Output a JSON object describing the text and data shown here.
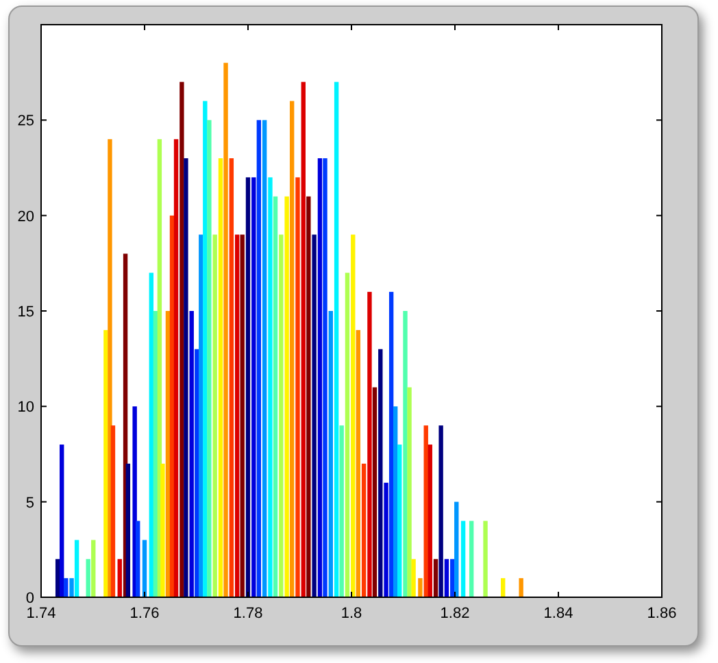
{
  "figure": {
    "chart_data": {
      "type": "bar",
      "xlim": [
        1.74,
        1.86
      ],
      "ylim": [
        0,
        30
      ],
      "xticks": [
        {
          "value": 1.74,
          "label": "1.74"
        },
        {
          "value": 1.76,
          "label": "1.76"
        },
        {
          "value": 1.78,
          "label": "1.78"
        },
        {
          "value": 1.8,
          "label": "1.8"
        },
        {
          "value": 1.82,
          "label": "1.82"
        },
        {
          "value": 1.84,
          "label": "1.84"
        },
        {
          "value": 1.86,
          "label": "1.86"
        }
      ],
      "yticks": [
        0,
        5,
        10,
        15,
        20,
        25
      ],
      "x": [
        1.7432,
        1.744,
        1.7448,
        1.7459,
        1.7469,
        1.7491,
        1.7501,
        1.7525,
        1.7533,
        1.7539,
        1.7552,
        1.7563,
        1.7568,
        1.7581,
        1.7587,
        1.76,
        1.7613,
        1.7621,
        1.7629,
        1.7635,
        1.7645,
        1.7653,
        1.7661,
        1.7672,
        1.768,
        1.7691,
        1.7701,
        1.7709,
        1.7717,
        1.7725,
        1.7736,
        1.7747,
        1.7757,
        1.7768,
        1.7779,
        1.7789,
        1.78,
        1.7811,
        1.7821,
        1.7832,
        1.7843,
        1.7853,
        1.7864,
        1.7875,
        1.7885,
        1.7896,
        1.7907,
        1.7917,
        1.7928,
        1.7939,
        1.7949,
        1.796,
        1.7971,
        1.7981,
        1.7992,
        1.8003,
        1.8013,
        1.8024,
        1.8035,
        1.8045,
        1.8056,
        1.8067,
        1.8077,
        1.8085,
        1.8093,
        1.8104,
        1.8112,
        1.812,
        1.8133,
        1.8144,
        1.8152,
        1.8163,
        1.8173,
        1.8184,
        1.8195,
        1.8203,
        1.8216,
        1.8232,
        1.8259,
        1.8293,
        1.8328
      ],
      "values": [
        2,
        8,
        1,
        1,
        3,
        2,
        3,
        14,
        24,
        9,
        2,
        18,
        7,
        10,
        4,
        3,
        17,
        15,
        24,
        7,
        15,
        20,
        24,
        27,
        23,
        15,
        13,
        19,
        26,
        25,
        19,
        23,
        28,
        23,
        19,
        19,
        22,
        22,
        25,
        25,
        22,
        21,
        19,
        21,
        26,
        22,
        27,
        21,
        19,
        23,
        23,
        15,
        27,
        9,
        17,
        19,
        14,
        7,
        16,
        11,
        13,
        6,
        16,
        10,
        8,
        15,
        11,
        2,
        1,
        9,
        8,
        2,
        9,
        2,
        2,
        5,
        4,
        4,
        4,
        1,
        1
      ]
    }
  }
}
